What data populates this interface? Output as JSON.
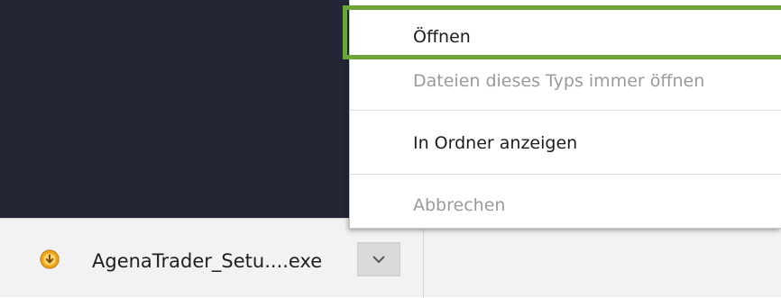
{
  "download_bar": {
    "filename": "AgenaTrader_Setu....exe",
    "status_icon": "download-in-progress-icon",
    "menu_toggle_icon": "chevron-down-icon"
  },
  "context_menu": {
    "items": [
      {
        "label": "Öffnen",
        "enabled": true,
        "highlighted": true
      },
      {
        "label": "Dateien dieses Typs immer öffnen",
        "enabled": false
      },
      {
        "label": "In Ordner anzeigen",
        "enabled": true
      },
      {
        "label": "Abbrechen",
        "enabled": false
      }
    ]
  },
  "colors": {
    "page_background": "#232735",
    "download_bar_background": "#f2f2f2",
    "highlight": "#6ba53a",
    "icon_fill": "#f0a51e",
    "disabled_text": "#9a9a9a"
  }
}
